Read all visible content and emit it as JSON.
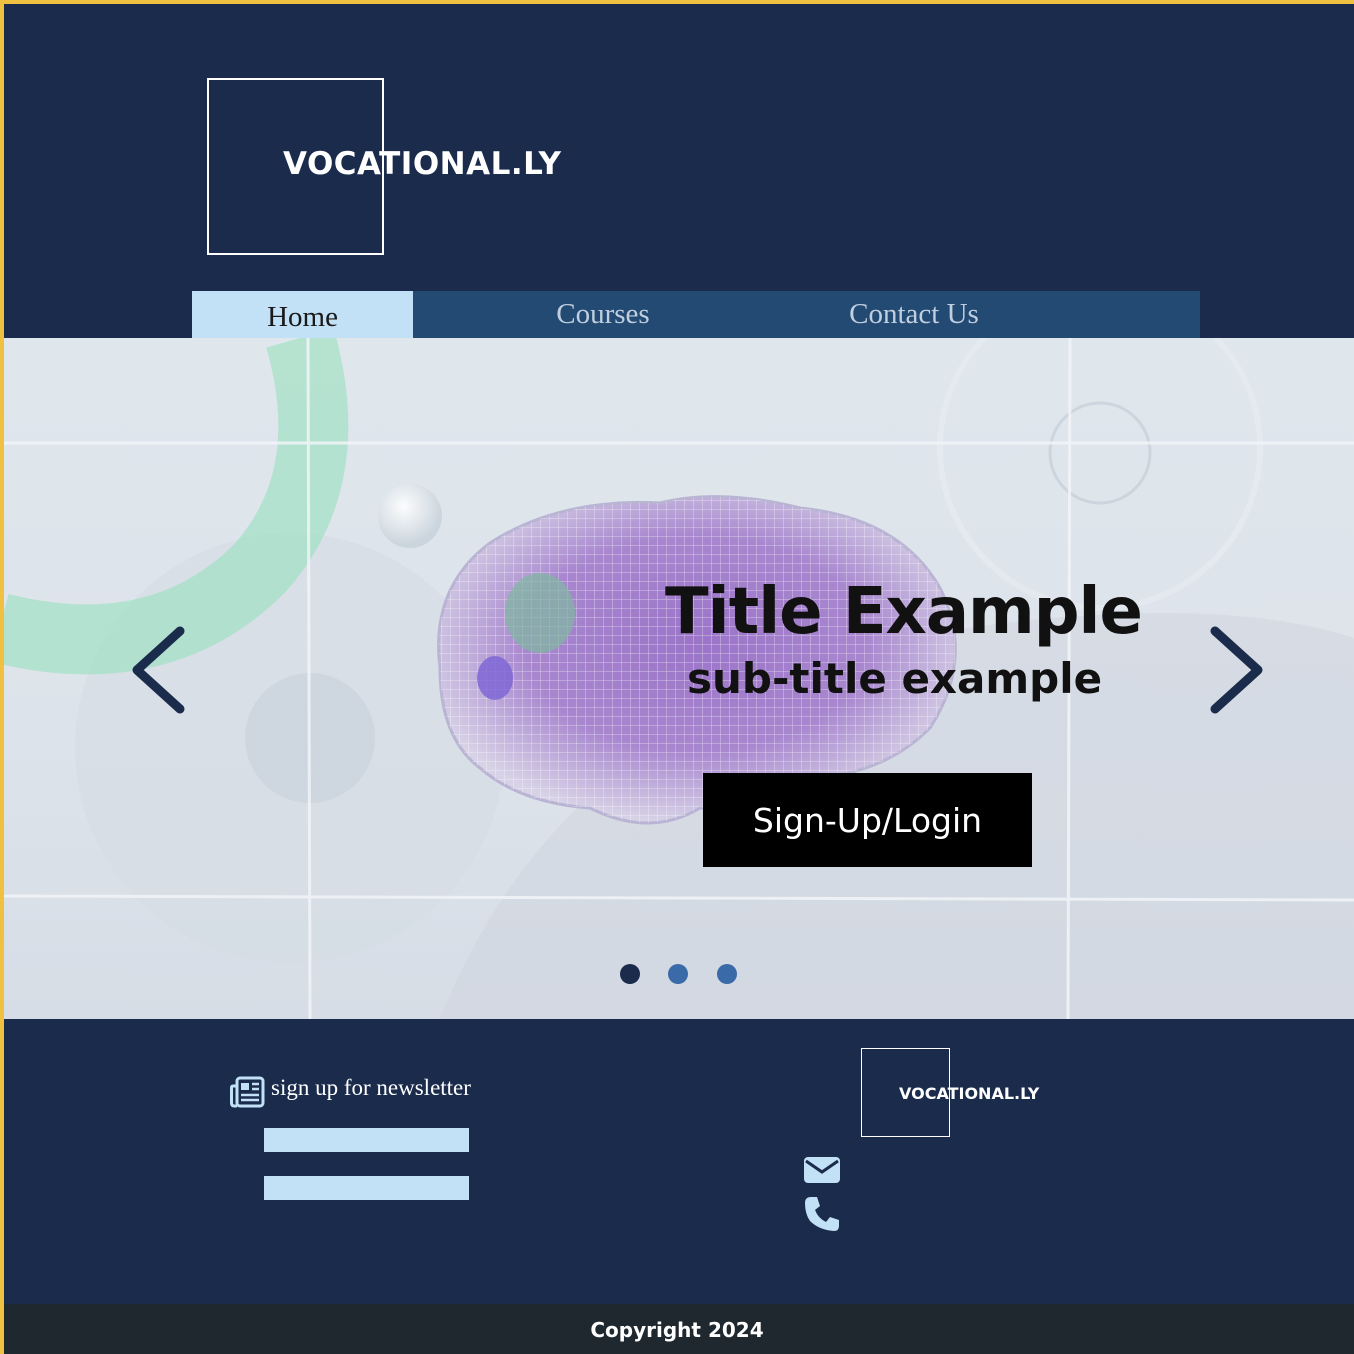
{
  "header": {
    "brand": "VOCATIONAL.LY"
  },
  "nav": {
    "items": [
      {
        "label": "Home",
        "active": true
      },
      {
        "label": "Courses",
        "active": false
      },
      {
        "label": "Contact Us",
        "active": false
      }
    ]
  },
  "hero": {
    "title": "Title Example",
    "subtitle": "sub-title example",
    "cta_label": "Sign-Up/Login",
    "prev_icon": "chevron-left-icon",
    "next_icon": "chevron-right-icon",
    "slides": {
      "count": 3,
      "active_index": 0
    },
    "colors": {
      "arrow": "#1a2b4c",
      "dot_active": "#1a2b4c",
      "dot_inactive": "#3b6aa8"
    }
  },
  "footer": {
    "newsletter_icon": "newspaper-icon",
    "newsletter_label": "sign up for newsletter",
    "brand": "VOCATIONAL.LY",
    "mail_icon": "envelope-icon",
    "phone_icon": "phone-icon",
    "copyright": "Copyright 2024"
  },
  "colors": {
    "navy": "#1a2b4c",
    "nav_bar": "#234a72",
    "nav_active": "#c2e0f6",
    "accent_border": "#f0c040",
    "bottom_bar": "#1f272f"
  }
}
